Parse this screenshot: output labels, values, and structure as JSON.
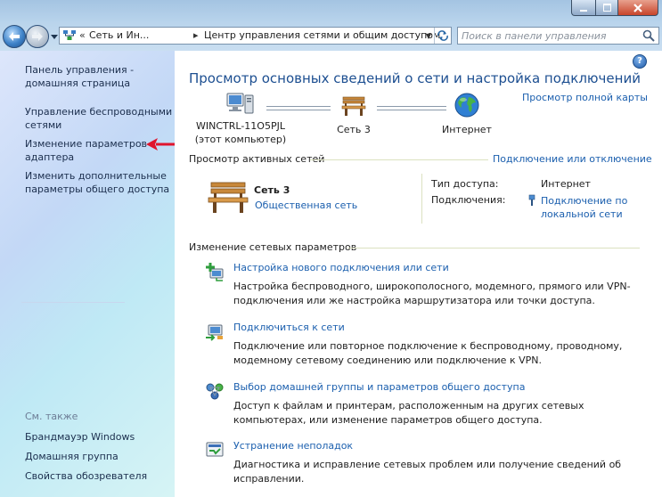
{
  "window": {
    "address": {
      "crumb_prefix": "«",
      "crumb_1": "Сеть и Ин...",
      "crumb_separator": "▸",
      "crumb_2": "Центр управления сетями и общим доступом"
    },
    "search": {
      "placeholder": "Поиск в панели управления"
    }
  },
  "sidebar": {
    "items": [
      {
        "label": "Панель управления -\nдомашняя страница"
      },
      {
        "label": "Управление беспроводными\nсетями"
      },
      {
        "label": "Изменение параметров\nадаптера"
      },
      {
        "label": "Изменить дополнительные\nпараметры общего доступа"
      }
    ],
    "see_also_title": "См. также",
    "see_also": [
      {
        "label": "Брандмауэр Windows"
      },
      {
        "label": "Домашняя группа"
      },
      {
        "label": "Свойства обозревателя"
      }
    ]
  },
  "main": {
    "help": "?",
    "title": "Просмотр основных сведений о сети и настройка подключений",
    "view_full_map": "Просмотр полной карты",
    "map": {
      "computer_name": "WINCTRL-11O5PJL",
      "computer_caption": "(этот компьютер)",
      "network_name": "Сеть  3",
      "internet": "Интернет"
    },
    "active_networks": {
      "title": "Просмотр активных сетей",
      "connect_link": "Подключение или отключение",
      "network_name": "Сеть  3",
      "network_type": "Общественная сеть",
      "access_type_label": "Тип доступа:",
      "access_type_value": "Интернет",
      "connections_label": "Подключения:",
      "connections_value": "Подключение по\nлокальной сети"
    },
    "change_settings": {
      "title": "Изменение сетевых параметров",
      "tasks": [
        {
          "icon": "new-connection-icon",
          "link": "Настройка нового подключения или сети",
          "desc": "Настройка беспроводного, широкополосного, модемного, прямого или VPN-подключения или же настройка маршрутизатора или точки доступа."
        },
        {
          "icon": "connect-network-icon",
          "link": "Подключиться к сети",
          "desc": "Подключение или повторное подключение к беспроводному, проводному, модемному сетевому соединению или подключение к VPN."
        },
        {
          "icon": "homegroup-icon",
          "link": "Выбор домашней группы и параметров общего доступа",
          "desc": "Доступ к файлам и принтерам, расположенным на других сетевых компьютерах, или изменение параметров общего доступа."
        },
        {
          "icon": "troubleshoot-icon",
          "link": "Устранение неполадок",
          "desc": "Диагностика и исправление сетевых проблем или получение сведений об исправлении."
        }
      ]
    }
  },
  "colors": {
    "link": "#1b5fae",
    "title": "#1d4f91",
    "annotation_arrow": "#e0142d"
  }
}
